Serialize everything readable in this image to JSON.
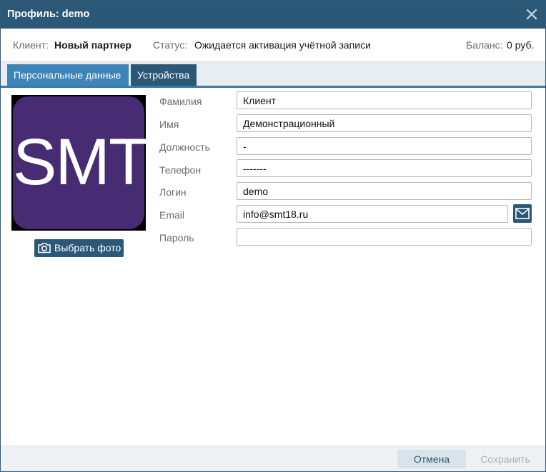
{
  "window": {
    "title": "Профиль: demo",
    "close_icon": "close-icon"
  },
  "info": {
    "client_label": "Клиент:",
    "client_value": "Новый партнер",
    "status_label": "Статус:",
    "status_value": "Ожидается активация учётной записи",
    "balance_label": "Баланс:",
    "balance_value": "0 руб."
  },
  "tabs": [
    {
      "label": "Персональные данные",
      "active": true
    },
    {
      "label": "Устройства",
      "active": false
    }
  ],
  "avatar": {
    "text": "SMT",
    "background": "#472c74"
  },
  "photo_button": {
    "label": "Выбрать фото",
    "icon": "camera-icon"
  },
  "fields": [
    {
      "label": "Фамилия",
      "value": "Клиент"
    },
    {
      "label": "Имя",
      "value": "Демонстрационный"
    },
    {
      "label": "Должность",
      "value": "-"
    },
    {
      "label": "Телефон",
      "value": "-------"
    },
    {
      "label": "Логин",
      "value": "demo"
    },
    {
      "label": "Email",
      "value": "info@smt18.ru"
    },
    {
      "label": "Пароль",
      "value": ""
    }
  ],
  "email_button_icon": "envelope-icon",
  "footer": {
    "cancel_label": "Отмена",
    "save_label": "Сохранить"
  },
  "colors": {
    "titlebar": "#2b5877",
    "tab_active": "#3d84b8",
    "tab_inactive": "#2b5877",
    "accent": "#3b79a6"
  }
}
